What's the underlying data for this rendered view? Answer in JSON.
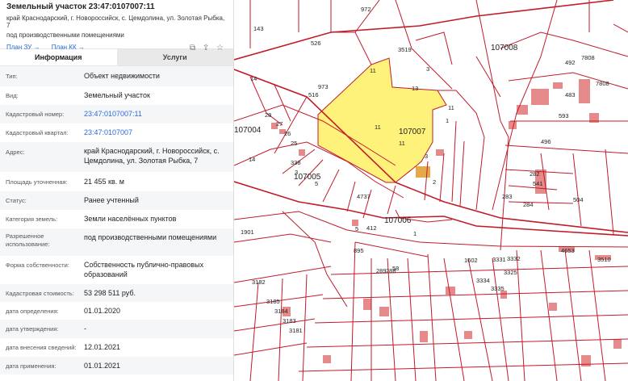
{
  "header": {
    "title": "Земельный участок 23:47:0107007:11",
    "address": "край Краснодарский, г. Новороссийск, с. Цемдолина, ул. Золотая Рыбка, 7",
    "purpose": "под производственными помещениями",
    "link_plan_zu": "План ЗУ →",
    "link_plan_kk": "План КК →"
  },
  "tabs": {
    "info": "Информация",
    "services": "Услуги"
  },
  "rows": [
    {
      "k": "Тип:",
      "v": "Объект недвижимости"
    },
    {
      "k": "Вид:",
      "v": "Земельный участок"
    },
    {
      "k": "Кадастровый номер:",
      "v": "23:47:0107007:11"
    },
    {
      "k": "Кадастровый квартал:",
      "v": "23:47:0107007"
    },
    {
      "k": "Адрес:",
      "v": "край Краснодарский, г. Новороссийск, с. Цемдолина, ул. Золотая Рыбка, 7"
    },
    {
      "k": "Площадь уточненная:",
      "v": "21 455 кв. м"
    },
    {
      "k": "Статус:",
      "v": "Ранее учтенный"
    },
    {
      "k": "Категория земель:",
      "v": "Земли населённых пунктов"
    },
    {
      "k": "Разрешенное использование:",
      "v": "под производственными помещениями"
    },
    {
      "k": "Форма собственности:",
      "v": "Собственность публично-правовых образований"
    },
    {
      "k": "Кадастровая стоимость:",
      "v": "53 298 511 руб."
    },
    {
      "k": "дата определения:",
      "v": "01.01.2020"
    },
    {
      "k": "дата утверждения:",
      "v": "-"
    },
    {
      "k": "дата внесения сведений:",
      "v": "12.01.2021"
    },
    {
      "k": "дата применения:",
      "v": "01.01.2021"
    }
  ],
  "map": {
    "quarters": [
      "107008",
      "107007",
      "107004",
      "107005",
      "107006"
    ],
    "labels": [
      "972",
      "143",
      "526",
      "3519",
      "973",
      "11",
      "13",
      "3",
      "11",
      "11",
      "516",
      "14",
      "28",
      "27",
      "26",
      "25",
      "14",
      "338",
      "3",
      "5",
      "4737",
      "3",
      "2",
      "1",
      "412",
      "5",
      "1",
      "1901",
      "895",
      "289",
      "288",
      "58",
      "3182",
      "3185",
      "3184",
      "3183",
      "3181",
      "1602",
      "3331",
      "3332",
      "3325",
      "3334",
      "3335",
      "4653",
      "3510",
      "504",
      "593",
      "496",
      "282",
      "283",
      "284",
      "7808",
      "7808",
      "492",
      "483",
      "541",
      "11"
    ],
    "colors": {
      "highlight": "#fff27a",
      "boundary": "#c11b2a",
      "building": "#e07a7a"
    }
  }
}
